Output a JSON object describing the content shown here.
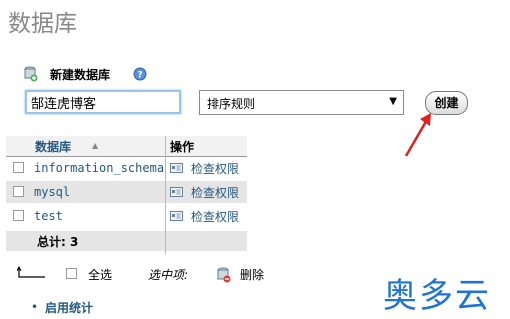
{
  "page_title": "数据库",
  "create_section": {
    "label": "新建数据库",
    "db_name_value": "郜连虎博客",
    "collation_value": "排序规则",
    "create_button": "创建"
  },
  "table": {
    "col_database": "数据库",
    "col_action": "操作",
    "rows": [
      {
        "name": "information_schema",
        "action": "检查权限"
      },
      {
        "name": "mysql",
        "action": "检查权限"
      },
      {
        "name": "test",
        "action": "检查权限"
      }
    ],
    "total": "总计: 3"
  },
  "bulk": {
    "check_all": "全选",
    "with_selected": "选中项:",
    "drop": "删除"
  },
  "stats_link": "启用统计",
  "watermark": "奥多云",
  "colors": {
    "link": "#235a81",
    "row_odd": "#ffffff",
    "row_even": "#e5e5e5",
    "header_bg": "#f2f2f2",
    "annotation_arrow": "#e0201e",
    "watermark": "#1f73d6"
  }
}
